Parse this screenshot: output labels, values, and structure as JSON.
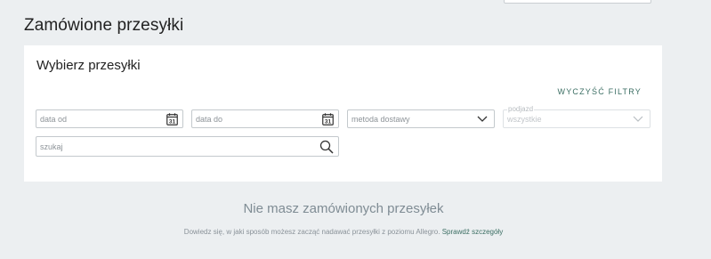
{
  "page": {
    "title": "Zamówione przesyłki"
  },
  "filters": {
    "panel_title": "Wybierz przesyłki",
    "clear_label": "WYCZYŚĆ FILTRY",
    "date_from_placeholder": "data od",
    "date_from_day": "31",
    "date_to_placeholder": "data do",
    "date_to_day": "31",
    "delivery_method_placeholder": "metoda dostawy",
    "entry_label": "podjazd",
    "entry_value": "wszystkie",
    "search_placeholder": "szukaj"
  },
  "empty_state": {
    "title": "Nie masz zamówionych przesyłek",
    "text": "Dowiedz się, w jaki sposób możesz zacząć nadawać przesyłki z poziomu Allegro.",
    "link": "Sprawdź szczegóły"
  },
  "icons": {
    "calendar": "calendar-icon",
    "chevron": "chevron-down-icon",
    "search": "search-icon"
  },
  "colors": {
    "accent": "#3b6e63",
    "background": "#eceff1"
  }
}
